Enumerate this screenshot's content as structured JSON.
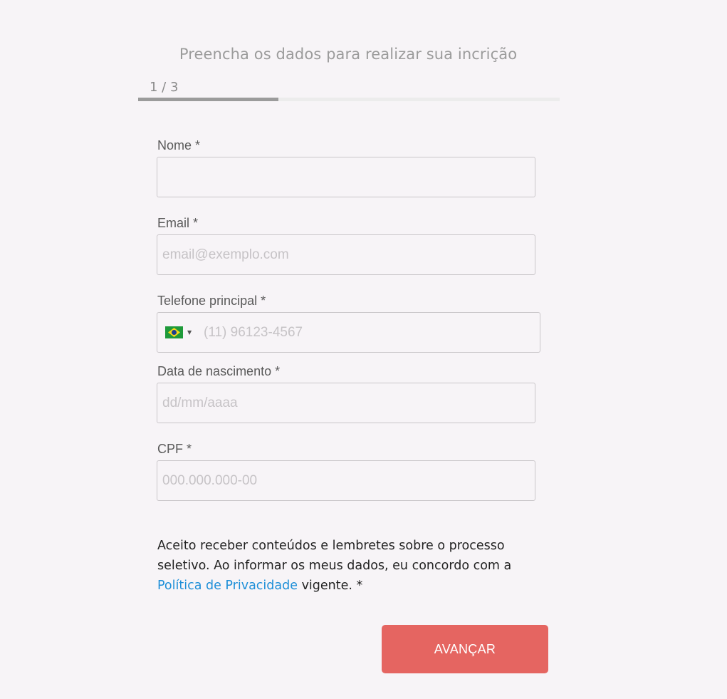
{
  "header": {
    "title": "Preencha os dados para realizar sua incrição",
    "step_label": "1 / 3",
    "progress_fraction": 0.333
  },
  "fields": {
    "name": {
      "label": "Nome *",
      "placeholder": ""
    },
    "email": {
      "label": "Email *",
      "placeholder": "email@exemplo.com"
    },
    "phone": {
      "label": "Telefone principal *",
      "placeholder": "(11) 96123-4567",
      "country": "Brazil",
      "flag_icon": "brazil-flag-icon"
    },
    "birthdate": {
      "label": "Data de nascimento *",
      "placeholder": "dd/mm/aaaa"
    },
    "cpf": {
      "label": "CPF *",
      "placeholder": "000.000.000-00"
    }
  },
  "consent": {
    "text_before": "Aceito receber conteúdos e lembretes sobre o processo seletivo. Ao informar os meus dados, eu concordo com a ",
    "link_text": "Política de Privacidade",
    "text_after": " vigente. *"
  },
  "submit": {
    "label": "AVANÇAR"
  },
  "colors": {
    "background": "#f7f4f7",
    "accent_button": "#e56561",
    "link": "#1e8fd8",
    "progress": "#9b9b9b"
  }
}
